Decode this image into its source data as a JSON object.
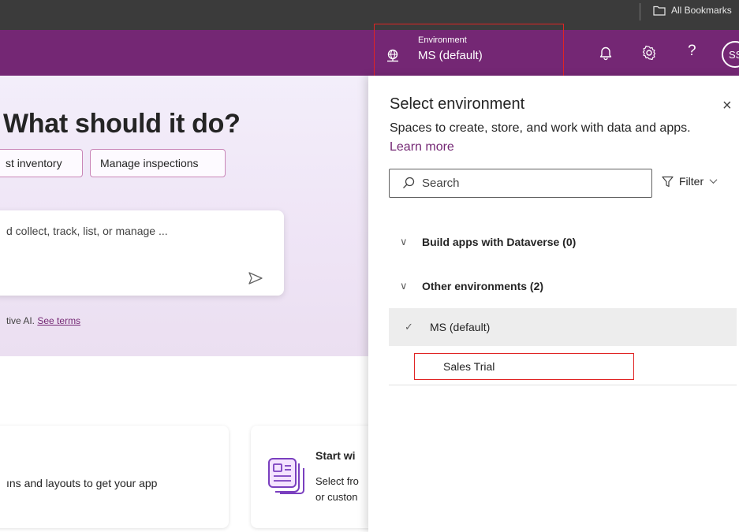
{
  "browser": {
    "bookmarks_folder_label": "All Bookmarks"
  },
  "header": {
    "environment_label": "Environment",
    "environment_value": "MS (default)",
    "help_glyph": "?",
    "avatar_initials": "SS",
    "icons": [
      "environment-globe-icon",
      "bell-icon",
      "gear-icon",
      "help-icon"
    ],
    "colors": {
      "brand": "#742774",
      "highlight": "#e02424"
    }
  },
  "hero": {
    "title": "What should it do?",
    "chips": [
      "st inventory",
      "Manage inspections"
    ],
    "prompt_placeholder": "d collect, track, list, or manage ...",
    "ai_note": "tive AI.",
    "ai_note_link": "See terms"
  },
  "cards": {
    "left_text": "ıns and layouts to get your app",
    "right_title": "Start wi",
    "right_desc_line1": "Select fro",
    "right_desc_line2": "or custon"
  },
  "panel": {
    "title": "Select environment",
    "close_glyph": "×",
    "description": "Spaces to create, store, and work with data and apps.",
    "learn_more": "Learn more",
    "search_placeholder": "Search",
    "filter_label": "Filter",
    "groups": [
      {
        "label": "Build apps with Dataverse (0)",
        "chevron": "∨"
      },
      {
        "label": "Other environments (2)",
        "chevron": "∨"
      }
    ],
    "environments": [
      {
        "label": "MS (default)",
        "selected": true,
        "check": "✓"
      },
      {
        "label": "Sales Trial",
        "selected": false
      }
    ]
  }
}
